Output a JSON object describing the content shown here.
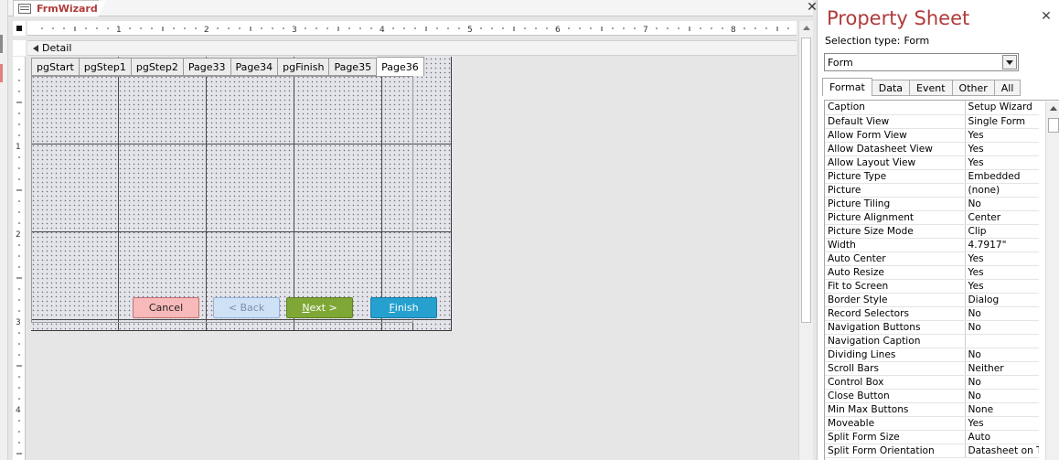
{
  "document_tab": {
    "label": "FrmWizard",
    "close": "✕"
  },
  "section": {
    "label": "Detail"
  },
  "ruler": {
    "h_numbers": [
      "1",
      "2",
      "3",
      "4",
      "5",
      "6",
      "7",
      "8"
    ],
    "v_numbers": [
      "1",
      "2",
      "3",
      "4"
    ]
  },
  "page_tabs": [
    "pgStart",
    "pgStep1",
    "pgStep2",
    "Page33",
    "Page34",
    "pgFinish",
    "Page35",
    "Page36"
  ],
  "active_page_tab": "Page36",
  "buttons": {
    "cancel": "Cancel",
    "back": "< Back",
    "next_ul": "N",
    "next_rest": "ext >",
    "finish_ul": "F",
    "finish_rest": "inish"
  },
  "button_colors": {
    "cancel": "#f7b9b9",
    "back": "#cfe1f5",
    "next": "#7fa736",
    "finish": "#26a0cf"
  },
  "property_sheet": {
    "title": "Property Sheet",
    "close": "✕",
    "selection_type_label": "Selection type:",
    "selection_type_value": "Form",
    "selector_value": "Form",
    "tabs": [
      "Format",
      "Data",
      "Event",
      "Other",
      "All"
    ],
    "active_tab": "Format",
    "properties": [
      {
        "name": "Caption",
        "value": "Setup Wizard"
      },
      {
        "name": "Default View",
        "value": "Single Form"
      },
      {
        "name": "Allow Form View",
        "value": "Yes"
      },
      {
        "name": "Allow Datasheet View",
        "value": "Yes"
      },
      {
        "name": "Allow Layout View",
        "value": "Yes"
      },
      {
        "name": "Picture Type",
        "value": "Embedded"
      },
      {
        "name": "Picture",
        "value": "(none)"
      },
      {
        "name": "Picture Tiling",
        "value": "No"
      },
      {
        "name": "Picture Alignment",
        "value": "Center"
      },
      {
        "name": "Picture Size Mode",
        "value": "Clip"
      },
      {
        "name": "Width",
        "value": "4.7917\""
      },
      {
        "name": "Auto Center",
        "value": "Yes"
      },
      {
        "name": "Auto Resize",
        "value": "Yes"
      },
      {
        "name": "Fit to Screen",
        "value": "Yes"
      },
      {
        "name": "Border Style",
        "value": "Dialog"
      },
      {
        "name": "Record Selectors",
        "value": "No"
      },
      {
        "name": "Navigation Buttons",
        "value": "No"
      },
      {
        "name": "Navigation Caption",
        "value": ""
      },
      {
        "name": "Dividing Lines",
        "value": "No"
      },
      {
        "name": "Scroll Bars",
        "value": "Neither"
      },
      {
        "name": "Control Box",
        "value": "No"
      },
      {
        "name": "Close Button",
        "value": "No"
      },
      {
        "name": "Min Max Buttons",
        "value": "None"
      },
      {
        "name": "Moveable",
        "value": "Yes"
      },
      {
        "name": "Split Form Size",
        "value": "Auto"
      },
      {
        "name": "Split Form Orientation",
        "value": "Datasheet on T"
      }
    ]
  },
  "accent_color": "#b13a3a"
}
